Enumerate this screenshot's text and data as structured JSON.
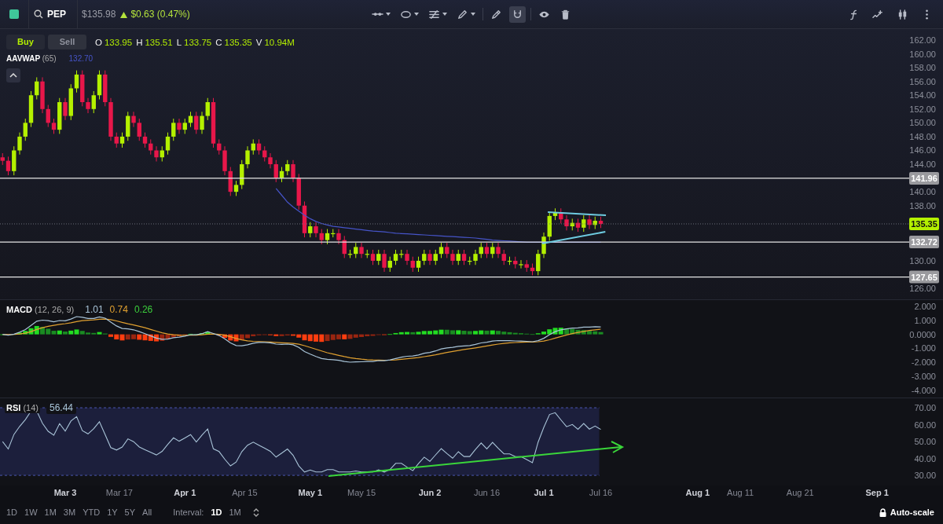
{
  "top_bar": {
    "symbol": "PEP",
    "price": "$135.98",
    "change_up": true,
    "change": "$0.63 (0.47%)",
    "tools": [
      {
        "kind": "line",
        "dropdown": true,
        "selected": false
      },
      {
        "kind": "ellipse",
        "dropdown": true,
        "selected": false
      },
      {
        "kind": "fib",
        "dropdown": true,
        "selected": false
      },
      {
        "kind": "brush",
        "dropdown": true,
        "selected": false
      },
      {
        "kind": "ruler",
        "dropdown": false,
        "selected": false
      },
      {
        "kind": "magnet",
        "dropdown": false,
        "selected": true
      },
      {
        "kind": "eye",
        "dropdown": false,
        "selected": false
      },
      {
        "kind": "trash",
        "dropdown": false,
        "selected": false
      }
    ],
    "right_tools": [
      {
        "kind": "formula"
      },
      {
        "kind": "indicator"
      },
      {
        "kind": "candles"
      },
      {
        "kind": "more"
      }
    ]
  },
  "trade_buttons": [
    {
      "label": "Buy",
      "kind": "buy"
    },
    {
      "label": "Sell",
      "kind": "sell"
    }
  ],
  "ohlcv": [
    {
      "key": "O",
      "value": "133.95"
    },
    {
      "key": "H",
      "value": "135.51"
    },
    {
      "key": "L",
      "value": "133.75"
    },
    {
      "key": "C",
      "value": "135.35"
    },
    {
      "key": "V",
      "value": "10.94M"
    }
  ],
  "overlay_legend": {
    "name": "AAVWAP",
    "params": "(65)",
    "value": "132.70"
  },
  "price_axis": [
    "162.00",
    "160.00",
    "158.00",
    "156.00",
    "154.00",
    "152.00",
    "150.00",
    "148.00",
    "146.00",
    "144.00",
    "140.00",
    "138.00",
    "130.00",
    "126.00"
  ],
  "price_tags": [
    {
      "label": "141.96",
      "kind": "level"
    },
    {
      "label": "135.35",
      "kind": "last"
    },
    {
      "label": "132.72",
      "kind": "level"
    },
    {
      "label": "127.65",
      "kind": "level"
    }
  ],
  "macd": {
    "kind": "macd",
    "name": "MACD",
    "params": "(12, 26, 9)",
    "values": [
      {
        "text": "1.01",
        "color": "#a9c4d8"
      },
      {
        "text": "0.74",
        "color": "#e0a030"
      },
      {
        "text": "0.26",
        "color": "#3ccf3c"
      }
    ],
    "axis_labels": [
      "2.000",
      "1.000",
      "0.0000",
      "-1.000",
      "-2.000",
      "-3.000",
      "-4.000"
    ]
  },
  "rsi": {
    "kind": "rsi",
    "name": "RSI",
    "params": "(14)",
    "values": [
      {
        "text": "56.44",
        "color": "#a9c4d8"
      }
    ],
    "axis_labels": [
      "70.00",
      "60.00",
      "50.00",
      "40.00",
      "30.00"
    ]
  },
  "time_axis": [
    {
      "label": "Mar 3",
      "bold": true
    },
    {
      "label": "Mar 17",
      "bold": false
    },
    {
      "label": "Apr 1",
      "bold": true
    },
    {
      "label": "Apr 15",
      "bold": false
    },
    {
      "label": "May 1",
      "bold": true
    },
    {
      "label": "May 15",
      "bold": false
    },
    {
      "label": "Jun 2",
      "bold": true
    },
    {
      "label": "Jun 16",
      "bold": false
    },
    {
      "label": "Jul 1",
      "bold": true
    },
    {
      "label": "Jul 16",
      "bold": false
    },
    {
      "label": "Aug 1",
      "bold": true
    },
    {
      "label": "Aug 11",
      "bold": false
    },
    {
      "label": "Aug 21",
      "bold": false
    },
    {
      "label": "Sep 1",
      "bold": true
    }
  ],
  "bottom_bar": {
    "ranges": [
      {
        "label": "1D",
        "selected": false
      },
      {
        "label": "1W",
        "selected": false
      },
      {
        "label": "1M",
        "selected": false
      },
      {
        "label": "3M",
        "selected": false
      },
      {
        "label": "YTD",
        "selected": false
      },
      {
        "label": "1Y",
        "selected": false
      },
      {
        "label": "5Y",
        "selected": false
      },
      {
        "label": "All",
        "selected": false
      }
    ],
    "interval_label": "Interval:",
    "intervals": [
      {
        "label": "1D",
        "selected": true
      },
      {
        "label": "1M",
        "selected": false
      }
    ],
    "autoscale": {
      "label": "Auto-scale",
      "locked": true
    }
  }
}
